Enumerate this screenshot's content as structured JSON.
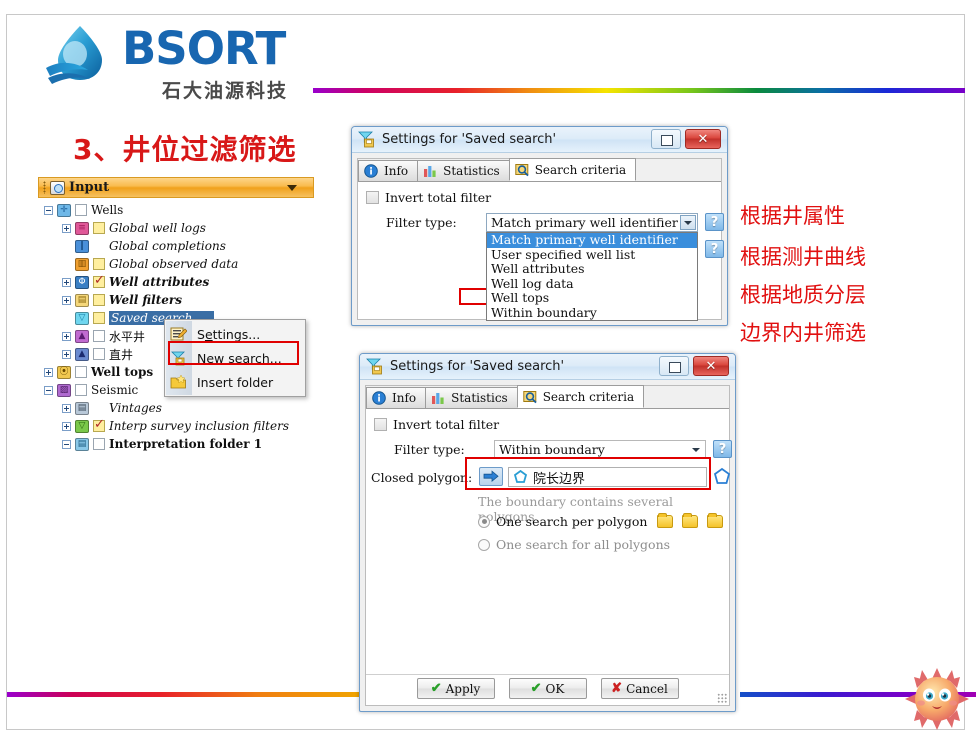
{
  "slide": {
    "title": "3、井位过滤筛选",
    "logo": {
      "brand": "BSORT",
      "subtitle": "石大油源科技",
      "icon": "water-drop-icon"
    }
  },
  "annotations": [
    "根据井属性",
    "根据测井曲线",
    "根据地质分层",
    "边界内井筛选"
  ],
  "tree_panel": {
    "header": {
      "label": "Input",
      "icon": "input-window-icon",
      "caret": "chevron-down-icon"
    },
    "nodes": [
      {
        "expander": "minus",
        "icon": "wells-icon",
        "checkbox": "white",
        "label": "Wells",
        "style": "normal",
        "indent": 0
      },
      {
        "expander": "plus",
        "icon": "global-well-logs-icon",
        "checkbox": "yellow",
        "label": "Global well logs",
        "style": "italic",
        "indent": 1
      },
      {
        "expander": "none",
        "icon": "completions-icon",
        "checkbox": "none",
        "label": "Global completions",
        "style": "italic",
        "indent": 1
      },
      {
        "expander": "none",
        "icon": "observed-data-icon",
        "checkbox": "yellow",
        "label": "Global observed data",
        "style": "italic",
        "indent": 1
      },
      {
        "expander": "plus",
        "icon": "well-attributes-icon",
        "checkbox": "checked",
        "label": "Well attributes",
        "style": "italic-bold",
        "indent": 1
      },
      {
        "expander": "plus",
        "icon": "well-filters-icon",
        "checkbox": "yellow",
        "label": "Well filters",
        "style": "italic-bold",
        "indent": 1
      },
      {
        "expander": "none",
        "icon": "saved-search-icon",
        "checkbox": "yellow",
        "label": "Saved search",
        "style": "selected",
        "indent": 1
      },
      {
        "expander": "plus",
        "icon": "horizontal-well-icon",
        "checkbox": "white",
        "label": "水平井",
        "style": "cjk",
        "indent": 1
      },
      {
        "expander": "plus",
        "icon": "vertical-well-icon",
        "checkbox": "white",
        "label": "直井",
        "style": "cjk",
        "indent": 1
      },
      {
        "expander": "plus",
        "icon": "well-tops-icon",
        "checkbox": "white",
        "label": "Well tops",
        "style": "bold",
        "indent": 0
      },
      {
        "expander": "minus",
        "icon": "seismic-icon",
        "checkbox": "white",
        "label": "Seismic",
        "style": "normal",
        "indent": 0
      },
      {
        "expander": "plus",
        "icon": "vintages-icon",
        "checkbox": "none",
        "label": "Vintages",
        "style": "italic",
        "indent": 1
      },
      {
        "expander": "plus",
        "icon": "interp-filters-icon",
        "checkbox": "checked",
        "label": "Interp survey inclusion filters",
        "style": "italic",
        "indent": 1
      },
      {
        "expander": "minus",
        "icon": "interp-folder-icon",
        "checkbox": "white",
        "label": "Interpretation folder 1",
        "style": "bold",
        "indent": 1
      }
    ]
  },
  "context_menu": {
    "items": [
      {
        "label_pre": "S",
        "label_underline": "e",
        "label_post": "ttings...",
        "icon": "settings-icon",
        "highlighted": false
      },
      {
        "label_pre": "New search...",
        "label_underline": "",
        "label_post": "",
        "icon": "new-search-icon",
        "highlighted": true
      },
      {
        "label_pre": "Insert folder",
        "label_underline": "",
        "label_post": "",
        "icon": "insert-folder-icon",
        "highlighted": false
      }
    ]
  },
  "dialog_top": {
    "title": "Settings for 'Saved search'",
    "title_icon": "saved-search-icon",
    "restore_button": "restore-icon",
    "close_button": "✕",
    "tabs": [
      {
        "label": "Info",
        "icon": "info-icon",
        "active": false
      },
      {
        "label": "Statistics",
        "icon": "statistics-icon",
        "active": false
      },
      {
        "label": "Search criteria",
        "icon": "search-criteria-icon",
        "active": true
      }
    ],
    "invert_label": "Invert total filter",
    "filter_type_label": "Filter type:",
    "filter_type_value": "Match primary well identifier",
    "help_label": "?",
    "dropdown_options": [
      "Match primary well identifier",
      "User specified well list",
      "Well attributes",
      "Well log data",
      "Well tops",
      "Within boundary"
    ],
    "dropdown_selected_index": 0,
    "dropdown_highlight_box_index": 5
  },
  "dialog_bottom": {
    "title": "Settings for 'Saved search'",
    "title_icon": "saved-search-icon",
    "restore_button": "restore-icon",
    "close_button": "✕",
    "tabs": [
      {
        "label": "Info",
        "icon": "info-icon",
        "active": false
      },
      {
        "label": "Statistics",
        "icon": "statistics-icon",
        "active": false
      },
      {
        "label": "Search criteria",
        "icon": "search-criteria-icon",
        "active": true
      }
    ],
    "invert_label": "Invert total filter",
    "filter_type_label": "Filter type:",
    "filter_type_value": "Within boundary",
    "help_label": "?",
    "closed_polygon_label": "Closed polygon:",
    "closed_polygon_value": "院长边界",
    "boundary_note": "The boundary contains several polygons",
    "radio_options": [
      {
        "label": "One search per polygon",
        "selected": true,
        "folders": 3
      },
      {
        "label": "One search for all polygons",
        "selected": false,
        "folders": 0
      }
    ],
    "buttons": [
      {
        "label": "Apply",
        "glyph": "✔",
        "glyph_type": "check"
      },
      {
        "label": "OK",
        "glyph": "✔",
        "glyph_type": "check"
      },
      {
        "label": "Cancel",
        "glyph": "✘",
        "glyph_type": "x"
      }
    ]
  },
  "decor": {
    "sun": "sun-face-icon"
  },
  "colors": {
    "accent_red": "#e11010",
    "title_red": "#d81818",
    "brand_blue": "#1866b0",
    "highlight_blue": "#3a6ea5",
    "panel_orange": "#f0a11c"
  }
}
